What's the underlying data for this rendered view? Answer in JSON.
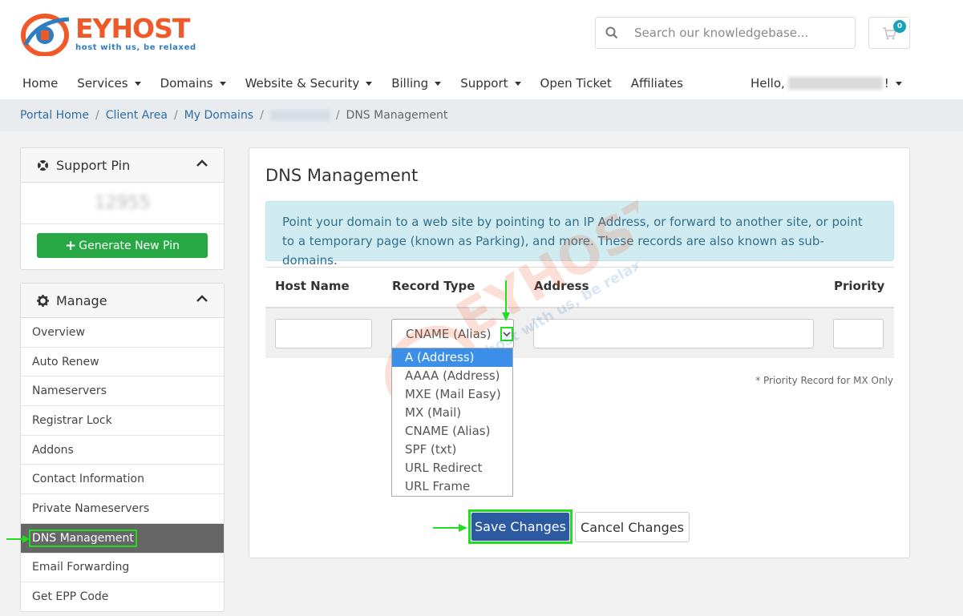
{
  "brand": {
    "logo_letters": "EYHOST",
    "tagline": "host with us, be relaxed",
    "accent": "#f05a28",
    "secondary": "#2e7dc1"
  },
  "header": {
    "search_placeholder": "Search our knowledgebase...",
    "cart_count": "0",
    "nav": [
      "Home",
      "Services",
      "Domains",
      "Website & Security",
      "Billing",
      "Support",
      "Open Ticket",
      "Affiliates"
    ],
    "nav_has_caret": [
      false,
      true,
      true,
      true,
      true,
      true,
      false,
      false
    ],
    "hello_prefix": "Hello,",
    "hello_suffix": "!"
  },
  "breadcrumb": {
    "items": [
      "Portal Home",
      "Client Area",
      "My Domains"
    ],
    "separator": "/",
    "current": "DNS Management"
  },
  "sidebar": {
    "support_pin": {
      "title": "Support Pin",
      "pin_value": "12955",
      "generate_label": "Generate New Pin"
    },
    "manage": {
      "title": "Manage",
      "items": [
        "Overview",
        "Auto Renew",
        "Nameservers",
        "Registrar Lock",
        "Addons",
        "Contact Information",
        "Private Nameservers",
        "DNS Management",
        "Email Forwarding",
        "Get EPP Code"
      ],
      "active_index": 7
    }
  },
  "main": {
    "title": "DNS Management",
    "info": "Point your domain to a web site by pointing to an IP Address, or forward to another site, or point to a temporary page (known as Parking), and more. These records are also known as sub-domains.",
    "columns": {
      "host": "Host Name",
      "type": "Record Type",
      "address": "Address",
      "priority": "Priority"
    },
    "record_type_value": "CNAME (Alias)",
    "record_type_options": [
      "A (Address)",
      "AAAA (Address)",
      "MXE (Mail Easy)",
      "MX (Mail)",
      "CNAME (Alias)",
      "SPF (txt)",
      "URL Redirect",
      "URL Frame"
    ],
    "highlighted_option_index": 0,
    "priority_note": "* Priority Record for MX Only",
    "save_label": "Save Changes",
    "cancel_label": "Cancel Changes"
  },
  "colors": {
    "save": "#2c5aa0",
    "generate": "#28a745",
    "alert_bg": "#d1ecf1",
    "active_menu": "#666666",
    "annotation": "#22dd22",
    "dropdown_highlight": "#3b8fe8"
  }
}
